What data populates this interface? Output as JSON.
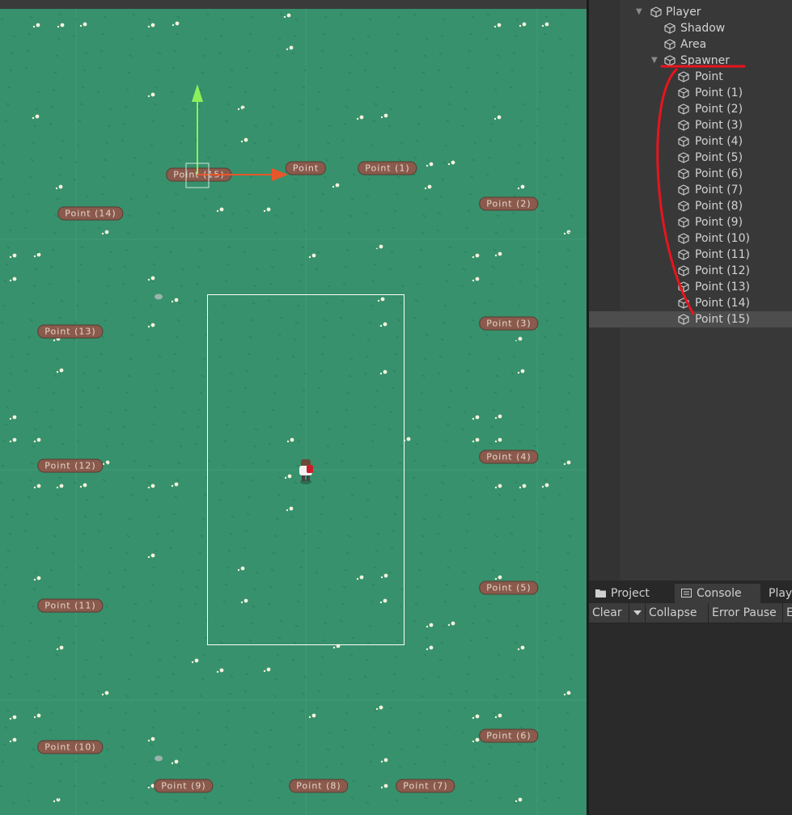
{
  "scene": {
    "point_labels": [
      {
        "id": "point",
        "text": "Point"
      },
      {
        "id": "point-1",
        "text": "Point (1)"
      },
      {
        "id": "point-2",
        "text": "Point (2)"
      },
      {
        "id": "point-3",
        "text": "Point (3)"
      },
      {
        "id": "point-4",
        "text": "Point (4)"
      },
      {
        "id": "point-5",
        "text": "Point (5)"
      },
      {
        "id": "point-6",
        "text": "Point (6)"
      },
      {
        "id": "point-7",
        "text": "Point (7)"
      },
      {
        "id": "point-8",
        "text": "Point (8)"
      },
      {
        "id": "point-9",
        "text": "Point (9)"
      },
      {
        "id": "point-10",
        "text": "Point (10)"
      },
      {
        "id": "point-11",
        "text": "Point (11)"
      },
      {
        "id": "point-12",
        "text": "Point (12)"
      },
      {
        "id": "point-13",
        "text": "Point (13)"
      },
      {
        "id": "point-14",
        "text": "Point (14)"
      },
      {
        "id": "point-15",
        "text": "Point (15)"
      }
    ],
    "grass_color": "#36916c",
    "gizmo_x_color": "#e8562a",
    "gizmo_y_color": "#8cf05a"
  },
  "hierarchy": {
    "items": [
      {
        "id": "player",
        "label": "Player",
        "expanded": true
      },
      {
        "id": "shadow",
        "label": "Shadow"
      },
      {
        "id": "area",
        "label": "Area"
      },
      {
        "id": "spawner",
        "label": "Spawner",
        "expanded": true
      },
      {
        "id": "point",
        "label": "Point"
      },
      {
        "id": "point-1",
        "label": "Point (1)"
      },
      {
        "id": "point-2",
        "label": "Point (2)"
      },
      {
        "id": "point-3",
        "label": "Point (3)"
      },
      {
        "id": "point-4",
        "label": "Point (4)"
      },
      {
        "id": "point-5",
        "label": "Point (5)"
      },
      {
        "id": "point-6",
        "label": "Point (6)"
      },
      {
        "id": "point-7",
        "label": "Point (7)"
      },
      {
        "id": "point-8",
        "label": "Point (8)"
      },
      {
        "id": "point-9",
        "label": "Point (9)"
      },
      {
        "id": "point-10",
        "label": "Point (10)"
      },
      {
        "id": "point-11",
        "label": "Point (11)"
      },
      {
        "id": "point-12",
        "label": "Point (12)"
      },
      {
        "id": "point-13",
        "label": "Point (13)"
      },
      {
        "id": "point-14",
        "label": "Point (14)"
      },
      {
        "id": "point-15",
        "label": "Point (15)",
        "selected": true
      }
    ]
  },
  "bottom_panel": {
    "tabs": [
      {
        "id": "project",
        "label": "Project"
      },
      {
        "id": "console",
        "label": "Console",
        "active": true
      },
      {
        "id": "play",
        "label": "Play"
      }
    ],
    "toolbar": {
      "clear": "Clear",
      "collapse": "Collapse",
      "error_pause": "Error Pause",
      "editor": "E"
    }
  },
  "annotation_color": "#e8141e"
}
